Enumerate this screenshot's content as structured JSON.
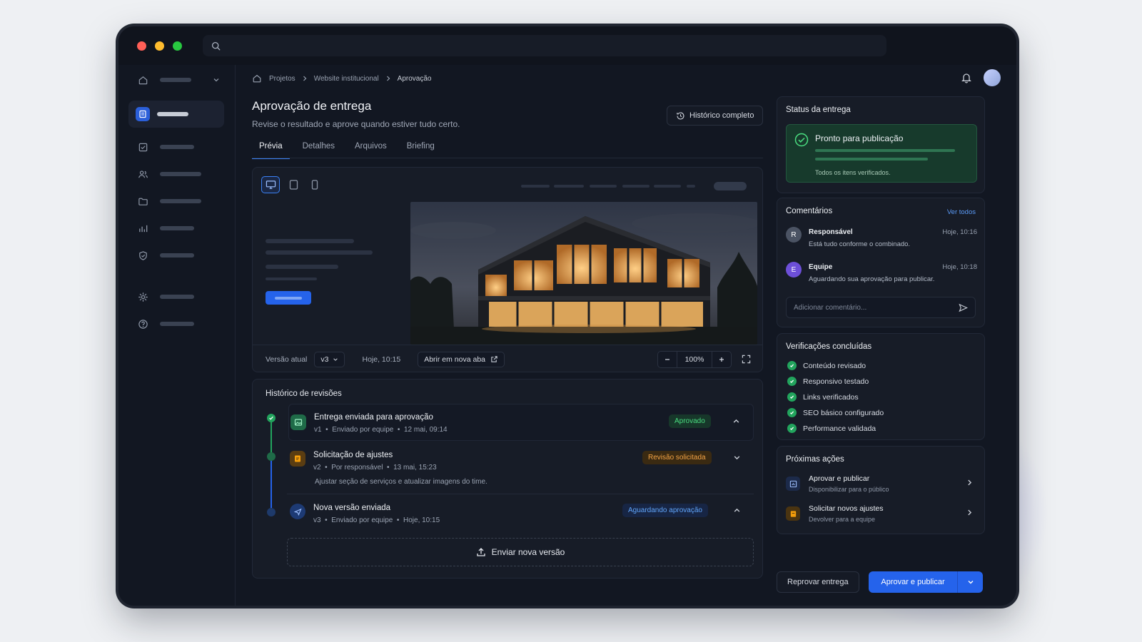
{
  "breadcrumb": [
    "Projetos",
    "Website institucional",
    "Aprovação"
  ],
  "page": {
    "title": "Aprovação de entrega",
    "subtitle": "Revise o resultado e aprove quando estiver tudo certo.",
    "history_button": "Histórico completo"
  },
  "tabs": [
    "Prévia",
    "Detalhes",
    "Arquivos",
    "Briefing"
  ],
  "preview": {
    "version_label": "Versão atual",
    "version_value": "v3",
    "timestamp": "Hoje, 10:15",
    "open_new_tab": "Abrir em nova aba",
    "zoom": "100%"
  },
  "revisions": {
    "title": "Histórico de revisões",
    "items": [
      {
        "name": "Entrega enviada para aprovação",
        "version": "v1",
        "by": "Enviado por equipe",
        "date": "12 mai, 09:14",
        "badge": "Aprovado"
      },
      {
        "name": "Solicitação de ajustes",
        "version": "v2",
        "by": "Por responsável",
        "date": "13 mai, 15:23",
        "badge": "Revisão solicitada",
        "note": "Ajustar seção de serviços e atualizar imagens do time."
      },
      {
        "name": "Nova versão enviada",
        "version": "v3",
        "by": "Enviado por equipe",
        "date": "Hoje, 10:15",
        "badge": "Aguardando aprovação"
      }
    ],
    "upload_label": "Enviar nova versão"
  },
  "status": {
    "title": "Status da entrega",
    "state": "Pronto para publicação",
    "note": "Todos os itens verificados."
  },
  "comments": {
    "title": "Comentários",
    "see_all": "Ver todos",
    "items": [
      {
        "initial": "R",
        "author": "Responsável",
        "time": "Hoje, 10:16",
        "text": "Está tudo conforme o combinado."
      },
      {
        "initial": "E",
        "author": "Equipe",
        "time": "Hoje, 10:18",
        "text": "Aguardando sua aprovação para publicar."
      }
    ],
    "input_placeholder": "Adicionar comentário..."
  },
  "checks": {
    "title": "Verificações concluídas",
    "items": [
      "Conteúdo revisado",
      "Responsivo testado",
      "Links verificados",
      "SEO básico configurado",
      "Performance validada"
    ]
  },
  "next_actions": {
    "title": "Próximas ações",
    "items": [
      {
        "title": "Aprovar e publicar",
        "subtitle": "Disponibilizar para o público"
      },
      {
        "title": "Solicitar novos ajustes",
        "subtitle": "Devolver para a equipe"
      }
    ]
  },
  "footer": {
    "reject": "Reprovar entrega",
    "approve": "Aprovar e publicar"
  },
  "colors": {
    "accent": "#2563eb",
    "success": "#22a45d",
    "warning": "#f59e0b",
    "background": "#121722"
  }
}
